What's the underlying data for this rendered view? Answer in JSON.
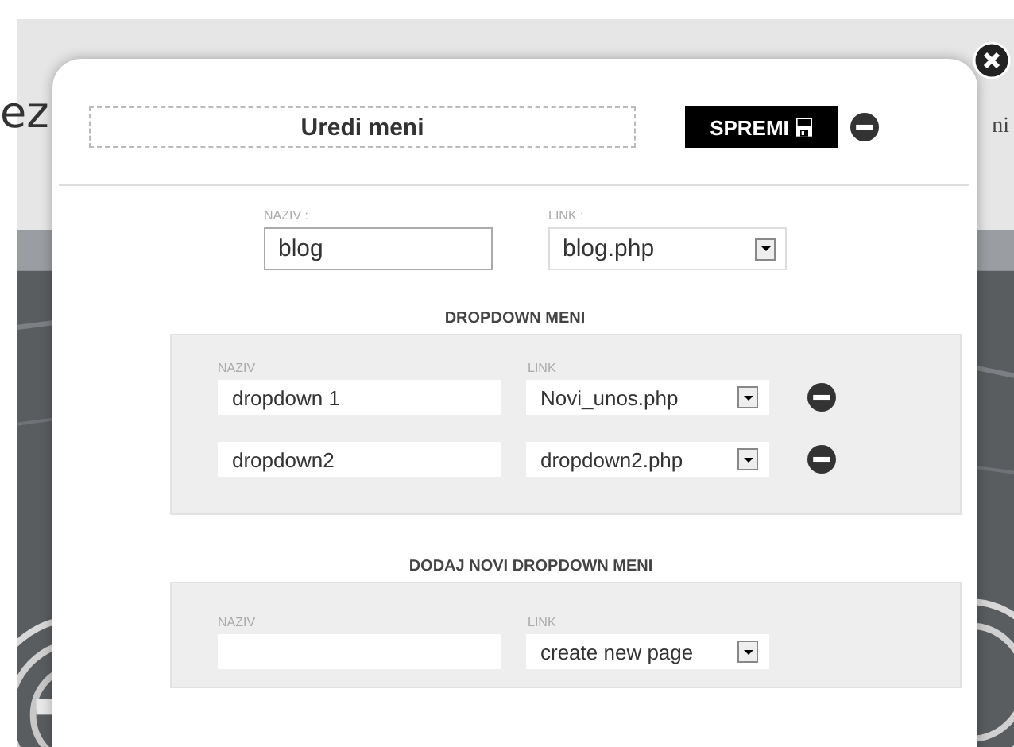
{
  "background": {
    "left_text": "ez",
    "right_text": "ni"
  },
  "modal": {
    "title": "Uredi meni",
    "save_button": "SPREMI",
    "item": {
      "name_label": "NAZIV :",
      "name_value": "blog",
      "link_label": "LINK :",
      "link_value": "blog.php"
    },
    "dropdown_section": {
      "heading": "DROPDOWN MENI",
      "name_label": "NAZIV",
      "link_label": "LINK",
      "rows": [
        {
          "name": "dropdown 1",
          "link": "Novi_unos.php"
        },
        {
          "name": "dropdown2",
          "link": "dropdown2.php"
        }
      ]
    },
    "new_section": {
      "heading": "DODAJ NOVI DROPDOWN MENI",
      "name_label": "NAZIV",
      "link_label": "LINK",
      "link_value": "create new page"
    }
  }
}
